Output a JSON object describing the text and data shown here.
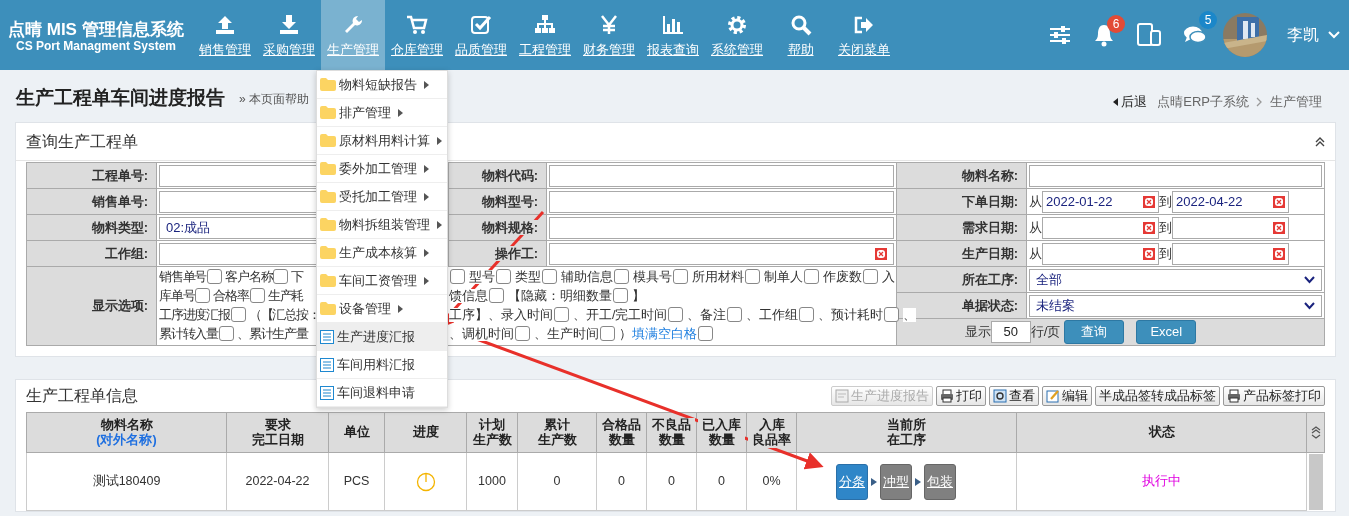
{
  "brand": {
    "title": "点晴 MIS 管理信息系统",
    "subtitle": "CS Port Managment System"
  },
  "nav": [
    {
      "label": "销售管理",
      "selected": false
    },
    {
      "label": "采购管理",
      "selected": false
    },
    {
      "label": "生产管理",
      "selected": true
    },
    {
      "label": "仓库管理",
      "selected": false
    },
    {
      "label": "品质管理",
      "selected": false
    },
    {
      "label": "工程管理",
      "selected": false
    },
    {
      "label": "财务管理",
      "selected": false
    },
    {
      "label": "报表查询",
      "selected": false
    },
    {
      "label": "系统管理",
      "selected": false
    },
    {
      "label": "帮助",
      "selected": false
    },
    {
      "label": "关闭菜单",
      "selected": false
    }
  ],
  "header_right": {
    "notifications": "6",
    "messages": "5",
    "user": "李凯"
  },
  "page": {
    "title": "生产工程单车间进度报告",
    "help": "» 本页面帮助",
    "back": "后退",
    "breadcrumb": [
      "点晴ERP子系统",
      "生产管理"
    ]
  },
  "menu": [
    {
      "kind": "folder",
      "label": "物料短缺报告",
      "highlighted": false
    },
    {
      "kind": "folder",
      "label": "排产管理",
      "highlighted": false
    },
    {
      "kind": "folder",
      "label": "原材料用料计算",
      "highlighted": false
    },
    {
      "kind": "folder",
      "label": "委外加工管理",
      "highlighted": false
    },
    {
      "kind": "folder",
      "label": "受托加工管理",
      "highlighted": false
    },
    {
      "kind": "folder",
      "label": "物料拆组装管理",
      "highlighted": false
    },
    {
      "kind": "folder",
      "label": "生产成本核算",
      "highlighted": false
    },
    {
      "kind": "folder",
      "label": "车间工资管理",
      "highlighted": false
    },
    {
      "kind": "folder",
      "label": "设备管理",
      "highlighted": false
    },
    {
      "kind": "page",
      "label": "生产进度汇报",
      "highlighted": true
    },
    {
      "kind": "page",
      "label": "车间用料汇报",
      "highlighted": false
    },
    {
      "kind": "page",
      "label": "车间退料申请",
      "highlighted": false
    }
  ],
  "query": {
    "title": "查询生产工程单",
    "rows": [
      [
        {
          "label": "工程单号:",
          "kind": "text"
        },
        {
          "label": "物料代码:",
          "kind": "text"
        },
        {
          "label": "物料名称:",
          "kind": "text"
        }
      ],
      [
        {
          "label": "销售单号:",
          "kind": "text"
        },
        {
          "label": "物料型号:",
          "kind": "text"
        },
        {
          "label": "下单日期:",
          "kind": "date_range",
          "from_label": "从",
          "from": "2022-01-22",
          "to_label": "到",
          "to": "2022-04-22"
        }
      ],
      [
        {
          "label": "物料类型:",
          "kind": "text",
          "value": "02:成品"
        },
        {
          "label": "物料规格:",
          "kind": "text"
        },
        {
          "label": "需求日期:",
          "kind": "date_range",
          "from_label": "从",
          "to_label": "到"
        }
      ],
      [
        {
          "label": "工作组:",
          "kind": "text"
        },
        {
          "label": "操作工:",
          "kind": "text",
          "clearable": true
        },
        {
          "label": "生产日期:",
          "kind": "date_range",
          "from_label": "从",
          "to_label": "到"
        }
      ]
    ],
    "options_label": "显示选项:",
    "options_left": [
      [
        {
          "kind": "check",
          "label": "销售单号",
          "checked": false
        },
        {
          "kind": "check",
          "label": "客户名称",
          "checked": false
        },
        {
          "kind": "text",
          "label": "下"
        }
      ],
      [
        {
          "kind": "check",
          "label": "库单号",
          "checked": false
        },
        {
          "kind": "check",
          "label": "合格率",
          "checked": false
        },
        {
          "kind": "text",
          "label": "生产耗"
        }
      ],
      [
        {
          "kind": "check",
          "label": "工序进度汇报",
          "checked": false
        },
        {
          "kind": "text",
          "label": "（【汇总按："
        }
      ],
      [
        {
          "kind": "check",
          "label": "累计转入量",
          "checked": false
        },
        {
          "kind": "text",
          "label": "、累计生产量"
        }
      ]
    ],
    "options_right": [
      [
        {
          "kind": "box",
          "checked": false
        },
        {
          "kind": "check",
          "label": "型号",
          "checked": false
        },
        {
          "kind": "check",
          "label": "类型",
          "checked": false
        },
        {
          "kind": "check",
          "label": "辅助信息",
          "checked": false
        },
        {
          "kind": "check",
          "label": "模具号",
          "checked": false
        },
        {
          "kind": "check",
          "label": "所用材料",
          "checked": false
        },
        {
          "kind": "check",
          "label": "制单人",
          "checked": false
        },
        {
          "kind": "check",
          "label": "作废数",
          "checked": false
        },
        {
          "kind": "text",
          "label": "入"
        }
      ],
      [
        {
          "kind": "check",
          "label": "馈信息",
          "checked": false
        },
        {
          "kind": "check",
          "label": "【隐藏：明细数量",
          "checked": false
        },
        {
          "kind": "text",
          "label": "】"
        }
      ],
      [
        {
          "kind": "check",
          "label": "工序】、录入时间",
          "checked": false
        },
        {
          "kind": "check",
          "label": "、开工/完工时间",
          "checked": false
        },
        {
          "kind": "check",
          "label": "、备注",
          "checked": false
        },
        {
          "kind": "check",
          "label": "、工作组",
          "checked": false
        },
        {
          "kind": "check",
          "label": "、预计耗时",
          "checked": false
        },
        {
          "kind": "text",
          "label": "、"
        }
      ],
      [
        {
          "kind": "check",
          "label": "、调机时间",
          "checked": false
        },
        {
          "kind": "check",
          "label": "、生产时间",
          "checked": false
        },
        {
          "kind": "text",
          "label": "）"
        },
        {
          "kind": "link_check",
          "label": "填满空白格",
          "checked": false
        }
      ]
    ],
    "selects": [
      {
        "label": "所在工序:",
        "value": "全部"
      },
      {
        "label": "单据状态:",
        "value": "未结案"
      }
    ],
    "paging": {
      "prefix": "显示",
      "value": "50",
      "suffix": "行/页"
    },
    "buttons": [
      "查询",
      "Excel"
    ]
  },
  "results": {
    "title": "生产工程单信息",
    "toolbar": [
      {
        "label": "生产进度报告",
        "disabled": true
      },
      {
        "label": "打印",
        "disabled": false
      },
      {
        "label": "查看",
        "disabled": false
      },
      {
        "label": "编辑",
        "disabled": false
      },
      {
        "label": "半成品签转成品标签",
        "disabled": false
      },
      {
        "label": "产品标签打印",
        "disabled": false
      }
    ],
    "columns": [
      [
        "物料名称",
        "(对外名称)"
      ],
      [
        "要求",
        "完工日期"
      ],
      [
        "单位"
      ],
      [
        "进度"
      ],
      [
        "计划",
        "生产数"
      ],
      [
        "累计",
        "生产数"
      ],
      [
        "合格品",
        "数量"
      ],
      [
        "不良品",
        "数量"
      ],
      [
        "已入库",
        "数量"
      ],
      [
        "入库",
        "良品率"
      ],
      [
        "当前所",
        "在工序"
      ],
      [
        "状态"
      ]
    ],
    "rows": [
      {
        "name": "测试180409",
        "due": "2022-04-22",
        "unit": "PCS",
        "planned": "1000",
        "produced": "0",
        "good": "0",
        "bad": "0",
        "stocked": "0",
        "yield": "0%",
        "steps": [
          {
            "label": "分条",
            "selected": true
          },
          {
            "label": "冲型",
            "selected": false
          },
          {
            "label": "包装",
            "selected": false
          }
        ],
        "status": "执行中"
      }
    ]
  }
}
